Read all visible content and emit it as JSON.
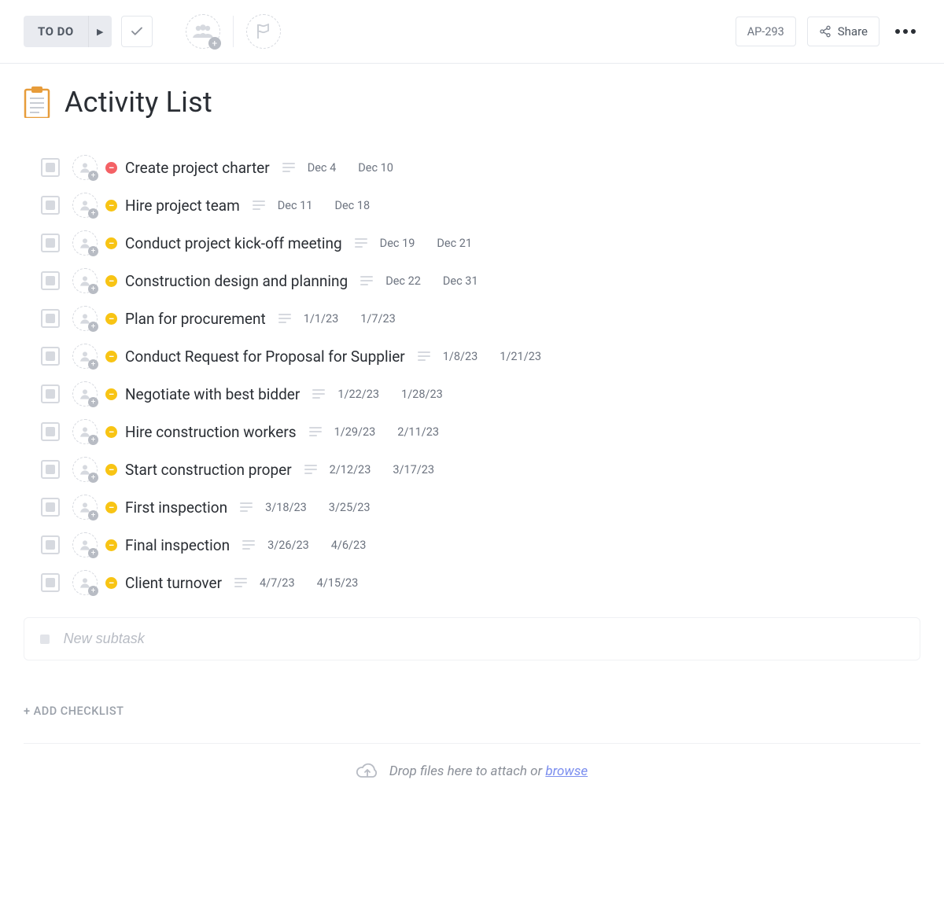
{
  "header": {
    "status_label": "TO DO",
    "task_id": "AP-293",
    "share_label": "Share"
  },
  "page": {
    "title": "Activity List",
    "new_subtask_placeholder": "New subtask",
    "add_checklist_label": "+ ADD CHECKLIST"
  },
  "dropzone": {
    "prefix": "Drop files here to attach or ",
    "browse": "browse"
  },
  "tasks": [
    {
      "priority": "red",
      "title": "Create project charter",
      "start": "Dec 4",
      "end": "Dec 10"
    },
    {
      "priority": "yellow",
      "title": "Hire project team",
      "start": "Dec 11",
      "end": "Dec 18"
    },
    {
      "priority": "yellow",
      "title": "Conduct project kick-off meeting",
      "start": "Dec 19",
      "end": "Dec 21"
    },
    {
      "priority": "yellow",
      "title": "Construction design and planning",
      "start": "Dec 22",
      "end": "Dec 31"
    },
    {
      "priority": "yellow",
      "title": "Plan for procurement",
      "start": "1/1/23",
      "end": "1/7/23"
    },
    {
      "priority": "yellow",
      "title": "Conduct Request for Proposal for Supplier",
      "start": "1/8/23",
      "end": "1/21/23"
    },
    {
      "priority": "yellow",
      "title": "Negotiate with best bidder",
      "start": "1/22/23",
      "end": "1/28/23"
    },
    {
      "priority": "yellow",
      "title": "Hire construction workers",
      "start": "1/29/23",
      "end": "2/11/23"
    },
    {
      "priority": "yellow",
      "title": "Start construction proper",
      "start": "2/12/23",
      "end": "3/17/23"
    },
    {
      "priority": "yellow",
      "title": "First inspection",
      "start": "3/18/23",
      "end": "3/25/23"
    },
    {
      "priority": "yellow",
      "title": "Final inspection",
      "start": "3/26/23",
      "end": "4/6/23"
    },
    {
      "priority": "yellow",
      "title": "Client turnover",
      "start": "4/7/23",
      "end": "4/15/23"
    }
  ]
}
